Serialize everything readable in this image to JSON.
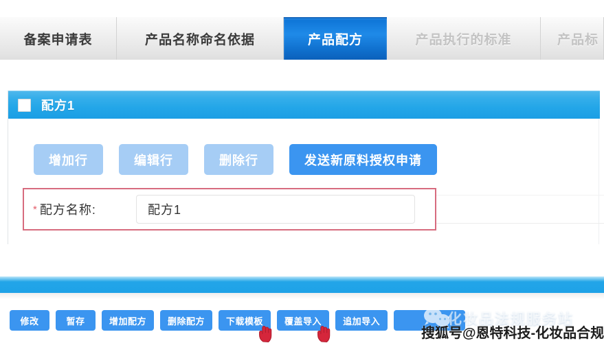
{
  "tabs": [
    {
      "label": "备案申请表",
      "state": "normal"
    },
    {
      "label": "产品名称命名依据",
      "state": "normal"
    },
    {
      "label": "产品配方",
      "state": "active"
    },
    {
      "label": "产品执行的标准",
      "state": "faded"
    },
    {
      "label": "产品标",
      "state": "faded"
    }
  ],
  "panel": {
    "title": "配方1",
    "checkbox_checked": false,
    "row_buttons": [
      {
        "label": "增加行",
        "style": "muted"
      },
      {
        "label": "编辑行",
        "style": "muted"
      },
      {
        "label": "删除行",
        "style": "muted"
      },
      {
        "label": "发送新原料授权申请",
        "style": "primary"
      }
    ],
    "field": {
      "required_mark": "*",
      "label": "配方名称:",
      "value": "配方1",
      "placeholder": ""
    }
  },
  "toolbar": {
    "buttons": [
      {
        "label": "修改"
      },
      {
        "label": "暂存"
      },
      {
        "label": "增加配方"
      },
      {
        "label": "删除配方"
      },
      {
        "label": "下载模板"
      },
      {
        "label": "覆盖导入"
      },
      {
        "label": "追加导入"
      },
      {
        "label": ""
      }
    ]
  },
  "watermark": {
    "icon": "wechat-icon",
    "line1": "化妆品法规服务站",
    "line2": "搜狐号@恩特科技-化妆品合规"
  },
  "cursors": [
    {
      "name": "pointing-hand-cursor-download-template"
    },
    {
      "name": "pointing-hand-cursor-overwrite-import"
    }
  ],
  "colors": {
    "tab_active": "#1071cf",
    "panel_header": "#23a6e8",
    "button_primary": "#3b95f0",
    "button_muted": "#a6cdf5",
    "required_red": "#e35d6a",
    "highlight_box": "#d76b7e",
    "blue_bar": "#1ea2e7"
  }
}
